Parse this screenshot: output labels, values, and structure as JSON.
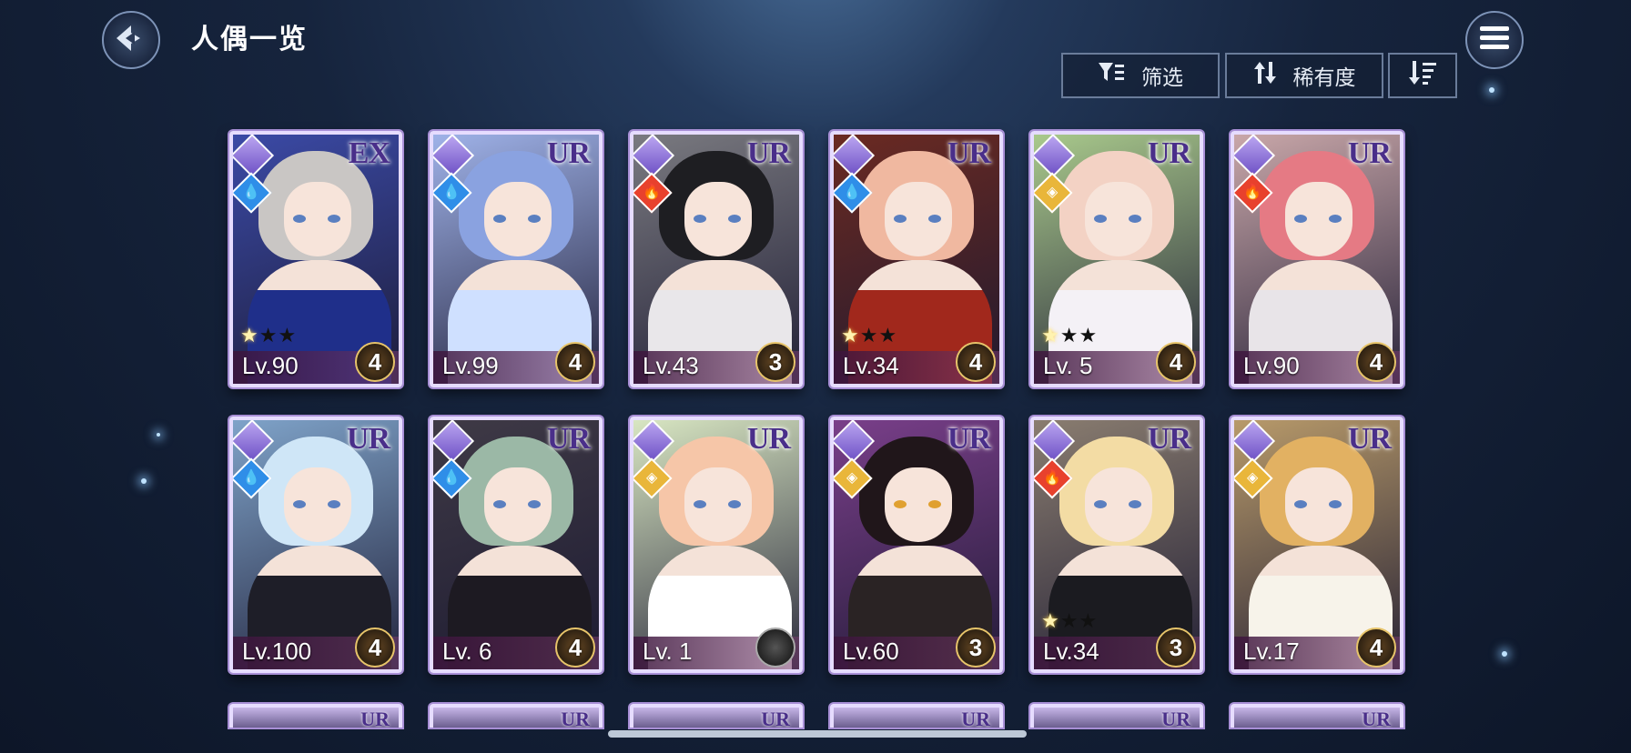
{
  "header": {
    "title": "人偶一览",
    "back_icon": "back-arrow-icon",
    "menu_icon": "hamburger-menu-icon"
  },
  "toolbar": {
    "filter_label": "筛选",
    "filter_icon": "filter-icon",
    "sort_label": "稀有度",
    "sort_icon": "sort-arrows-icon",
    "order_icon": "sort-order-icon"
  },
  "cards": [
    {
      "rarity": "EX",
      "level": "Lv.90",
      "grade": "4",
      "stars_on": 1,
      "stars_off": 2,
      "element": "water",
      "hair": "#c9c6c4",
      "outfit": "#1f2f8a",
      "bg": "#3b4aa6"
    },
    {
      "rarity": "UR",
      "level": "Lv.99",
      "grade": "4",
      "stars_on": 0,
      "stars_off": 0,
      "element": "water",
      "hair": "#8aa2e0",
      "outfit": "#cfe0ff",
      "bg": "#9fb2e8"
    },
    {
      "rarity": "UR",
      "level": "Lv.43",
      "grade": "3",
      "stars_on": 0,
      "stars_off": 0,
      "element": "fire",
      "hair": "#1e1e22",
      "outfit": "#e9e7ea",
      "bg": "#7a7a80"
    },
    {
      "rarity": "UR",
      "level": "Lv.34",
      "grade": "4",
      "stars_on": 1,
      "stars_off": 2,
      "element": "water",
      "hair": "#f0b8a0",
      "outfit": "#a1281c",
      "bg": "#6b2a22"
    },
    {
      "rarity": "UR",
      "level": "Lv. 5",
      "grade": "4",
      "stars_on": 1,
      "stars_off": 2,
      "element": "light",
      "hair": "#f3d2c4",
      "outfit": "#f4f1f6",
      "bg": "#a9c98c"
    },
    {
      "rarity": "UR",
      "level": "Lv.90",
      "grade": "4",
      "stars_on": 0,
      "stars_off": 0,
      "element": "fire",
      "hair": "#e57a84",
      "outfit": "#e8e4e8",
      "bg": "#c9a7a9"
    },
    {
      "rarity": "UR",
      "level": "Lv.100",
      "grade": "4",
      "stars_on": 0,
      "stars_off": 0,
      "element": "water",
      "hair": "#cfe6f7",
      "outfit": "#1e1e28",
      "bg": "#7fa3c9"
    },
    {
      "rarity": "UR",
      "level": "Lv. 6",
      "grade": "4",
      "stars_on": 0,
      "stars_off": 0,
      "element": "water",
      "hair": "#9bb8a6",
      "outfit": "#1d1a22",
      "bg": "#3f3a46"
    },
    {
      "rarity": "UR",
      "level": "Lv. 1",
      "grade": "",
      "stars_on": 0,
      "stars_off": 0,
      "element": "light",
      "hair": "#f6c6a8",
      "outfit": "#ffffff",
      "bg": "#d8e6c2"
    },
    {
      "rarity": "UR",
      "level": "Lv.60",
      "grade": "3",
      "stars_on": 0,
      "stars_off": 0,
      "element": "light",
      "hair": "#20161a",
      "outfit": "#2a2324",
      "bg": "#7a3f8a"
    },
    {
      "rarity": "UR",
      "level": "Lv.34",
      "grade": "3",
      "stars_on": 1,
      "stars_off": 2,
      "element": "fire",
      "hair": "#f3dca4",
      "outfit": "#1b1b20",
      "bg": "#8a7d70"
    },
    {
      "rarity": "UR",
      "level": "Lv.17",
      "grade": "4",
      "stars_on": 0,
      "stars_off": 0,
      "element": "light",
      "hair": "#e2b162",
      "outfit": "#f7f3ea",
      "bg": "#b89a6a"
    }
  ],
  "partial_row": [
    "UR",
    "UR",
    "UR",
    "UR",
    "UR",
    "UR"
  ],
  "colors": {
    "fire": "#e8412d",
    "water": "#2f8ee8",
    "light": "#e9b63a"
  }
}
